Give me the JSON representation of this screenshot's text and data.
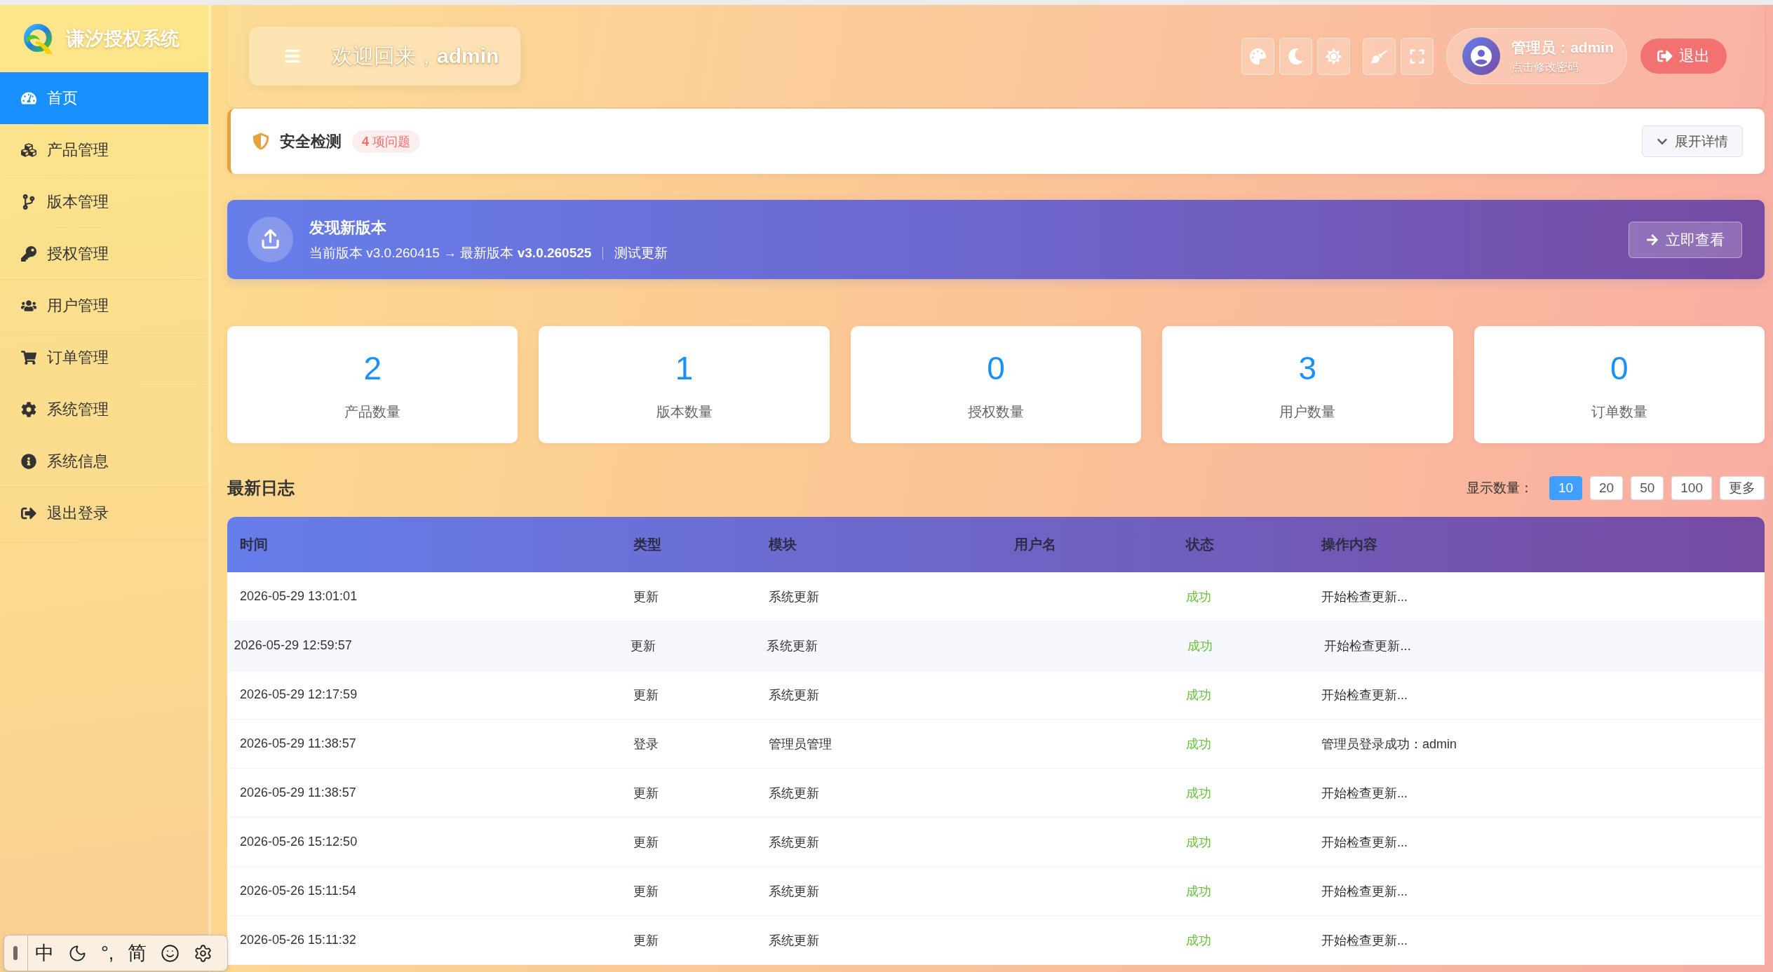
{
  "sidebar": {
    "title": "谦汐授权系统",
    "items": [
      {
        "label": "首页",
        "selected": true
      },
      {
        "label": "产品管理",
        "selected": false
      },
      {
        "label": "版本管理",
        "selected": false
      },
      {
        "label": "授权管理",
        "selected": false
      },
      {
        "label": "用户管理",
        "selected": false
      },
      {
        "label": "订单管理",
        "selected": false
      },
      {
        "label": "系统管理",
        "selected": false
      },
      {
        "label": "系统信息",
        "selected": false
      },
      {
        "label": "退出登录",
        "selected": false
      }
    ]
  },
  "header": {
    "welcome": "欢迎回来，**admin**",
    "user": {
      "name": "管理员：admin",
      "hint": "点击修改密码"
    },
    "logout": "退出"
  },
  "security": {
    "title": "安全检测",
    "badge": "**4** 项问题",
    "toggle": "展开详情"
  },
  "update_banner": {
    "title": "发现新版本",
    "detail": "当前版本 v3.0.260415 → 最新版本 **v3.0.260525**",
    "link": "测试更新",
    "button": "立即查看"
  },
  "stats": [
    {
      "value": "2",
      "label": "产品数量"
    },
    {
      "value": "1",
      "label": "版本数量"
    },
    {
      "value": "0",
      "label": "授权数量"
    },
    {
      "value": "3",
      "label": "用户数量"
    },
    {
      "value": "0",
      "label": "订单数量"
    }
  ],
  "logs": {
    "title": "最新日志",
    "page_size_label": "显示数量：",
    "page_sizes": [
      {
        "label": "10",
        "selected": true
      },
      {
        "label": "20",
        "selected": false
      },
      {
        "label": "50",
        "selected": false
      },
      {
        "label": "100",
        "selected": false
      }
    ],
    "more": "更多",
    "columns": [
      "时间",
      "类型",
      "模块",
      "用户名",
      "状态",
      "操作内容"
    ],
    "rows": [
      {
        "time": "2026-05-29 13:01:01",
        "type": "更新",
        "module": "系统更新",
        "status": "成功",
        "content": "开始检查更新...",
        "highlighted": false
      },
      {
        "time": "2026-05-29 12:59:57",
        "type": "更新",
        "module": "系统更新",
        "status": "成功",
        "content": "开始检查更新...",
        "highlighted": true
      },
      {
        "time": "2026-05-29 12:17:59",
        "type": "更新",
        "module": "系统更新",
        "status": "成功",
        "content": "开始检查更新...",
        "highlighted": false
      },
      {
        "time": "2026-05-29 11:38:57",
        "type": "登录",
        "module": "管理员管理",
        "status": "成功",
        "content": "管理员登录成功：admin",
        "highlighted": false
      },
      {
        "time": "2026-05-29 11:38:57",
        "type": "更新",
        "module": "系统更新",
        "status": "成功",
        "content": "开始检查更新...",
        "highlighted": false
      },
      {
        "time": "2026-05-26 15:12:50",
        "type": "更新",
        "module": "系统更新",
        "status": "成功",
        "content": "开始检查更新...",
        "highlighted": false
      },
      {
        "time": "2026-05-26 15:11:54",
        "type": "更新",
        "module": "系统更新",
        "status": "成功",
        "content": "开始检查更新...",
        "highlighted": false
      },
      {
        "time": "2026-05-26 15:11:32",
        "type": "更新",
        "module": "系统更新",
        "status": "成功",
        "content": "开始检查更新...",
        "highlighted": false
      }
    ]
  },
  "ime_toolbar": {
    "mode": "中",
    "punctuation": "°,",
    "script": "简"
  }
}
